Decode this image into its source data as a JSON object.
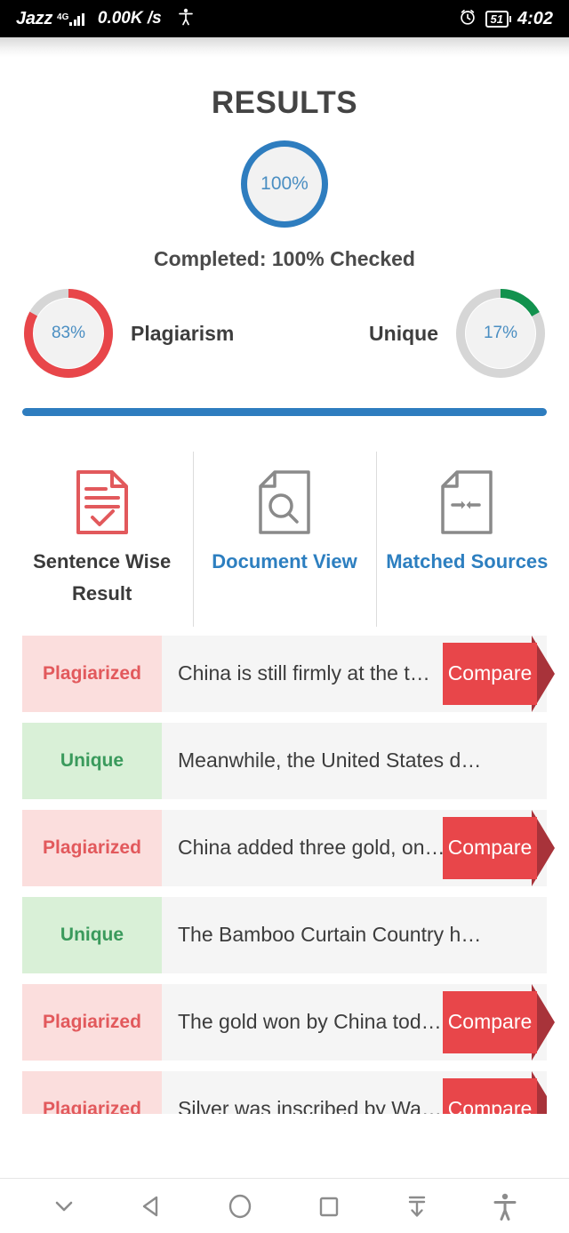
{
  "statusbar": {
    "carrier": "Jazz",
    "network": "4G",
    "speed": "0.00K /s",
    "accessibility_icon": "accessibility-icon",
    "alarm_icon": "alarm-icon",
    "battery": "51",
    "clock": "4:02"
  },
  "header": {
    "title": "RESULTS",
    "overall_percent": "100%",
    "completed_text": "Completed: 100% Checked"
  },
  "donuts": [
    {
      "value": "83%",
      "label": "Plagiarism",
      "percent": 83,
      "color": "#e8464a",
      "track": "#d6d6d6"
    },
    {
      "value": "17%",
      "label": "Unique",
      "percent": 17,
      "color": "#12924e",
      "track": "#d6d6d6"
    }
  ],
  "progress": {
    "percent": 100,
    "color": "#2e7dbf"
  },
  "tabs": [
    {
      "label": "Sentence Wise Result",
      "icon": "document-check-icon",
      "active": true,
      "color": "#e2595c"
    },
    {
      "label": "Document View",
      "icon": "document-search-icon",
      "active": false,
      "color": "#8a8a8a"
    },
    {
      "label": "Matched Sources",
      "icon": "document-arrows-icon",
      "active": false,
      "color": "#8a8a8a"
    }
  ],
  "results": {
    "compare_label": "Compare",
    "rows": [
      {
        "tag": "Plagiarized",
        "status": "plagiarized",
        "text": "China is still firmly at the t…",
        "compare": true
      },
      {
        "tag": "Unique",
        "status": "unique",
        "text": "Meanwhile, the United States d…",
        "compare": false
      },
      {
        "tag": "Plagiarized",
        "status": "plagiarized",
        "text": "China added three gold, on…",
        "compare": true
      },
      {
        "tag": "Unique",
        "status": "unique",
        "text": "The Bamboo Curtain Country h…",
        "compare": false
      },
      {
        "tag": "Plagiarized",
        "status": "plagiarized",
        "text": "The gold won by China tod…",
        "compare": true
      },
      {
        "tag": "Plagiarized",
        "status": "plagiarized",
        "text": "Silver was inscribed by Wa…",
        "compare": true
      }
    ]
  },
  "navbar": {
    "items": [
      {
        "icon": "chevron-down-icon"
      },
      {
        "icon": "back-triangle-icon"
      },
      {
        "icon": "home-circle-icon"
      },
      {
        "icon": "recents-square-icon"
      },
      {
        "icon": "scroll-down-icon"
      },
      {
        "icon": "accessibility-icon"
      }
    ]
  }
}
